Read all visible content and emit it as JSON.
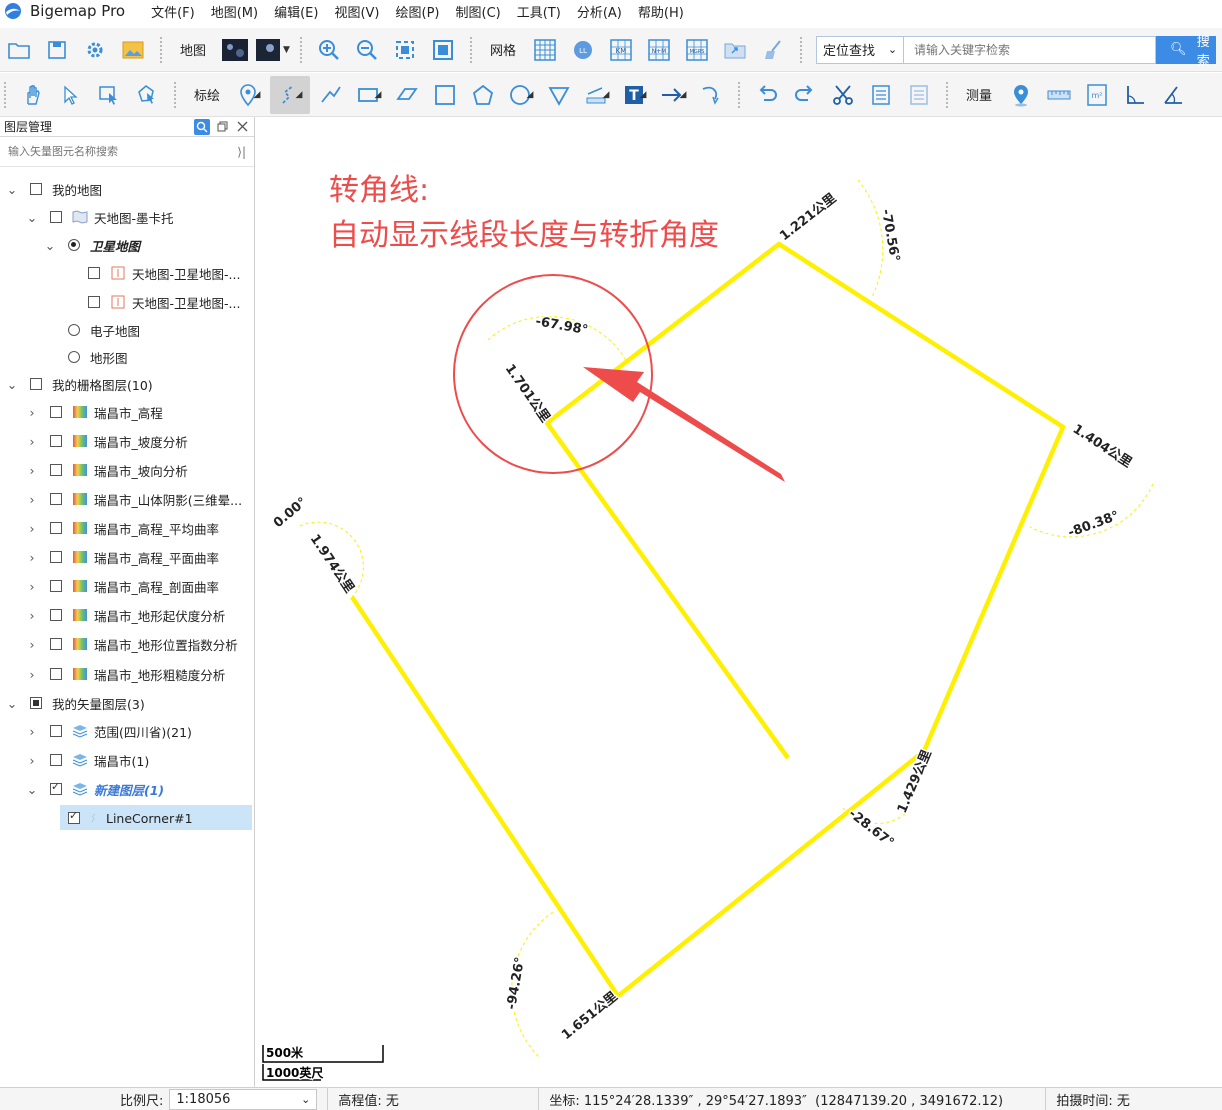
{
  "app": {
    "title": "Bigemap Pro"
  },
  "menu": [
    "文件(F)",
    "地图(M)",
    "编辑(E)",
    "视图(V)",
    "绘图(P)",
    "制图(C)",
    "工具(T)",
    "分析(A)",
    "帮助(H)"
  ],
  "toolbar1": {
    "map_label": "地图",
    "grid_label": "网格",
    "grid_icons": [
      "LL",
      "KM",
      "N+M",
      "MGRS"
    ],
    "locate_label": "定位查找",
    "search_placeholder": "请输入关键字检索",
    "search_button": "搜索"
  },
  "toolbar2": {
    "draw_label": "标绘",
    "text_tool_glyph": "T",
    "area_unit_glyph": "m²",
    "measure_label": "测量"
  },
  "layer_panel": {
    "title": "图层管理",
    "search_placeholder": "输入矢量图元名称搜索",
    "tree": [
      "我的地图",
      "天地图-墨卡托",
      "卫星地图",
      "天地图-卫星地图-...",
      "天地图-卫星地图-...",
      "电子地图",
      "地形图",
      "我的栅格图层(10)",
      "瑞昌市_高程",
      "瑞昌市_坡度分析",
      "瑞昌市_坡向分析",
      "瑞昌市_山体阴影(三维晕...",
      "瑞昌市_高程_平均曲率",
      "瑞昌市_高程_平面曲率",
      "瑞昌市_高程_剖面曲率",
      "瑞昌市_地形起伏度分析",
      "瑞昌市_地形位置指数分析",
      "瑞昌市_地形粗糙度分析",
      "我的矢量图层(3)",
      "范围(四川省)(21)",
      "瑞昌市(1)",
      "新建图层(1)",
      "LineCorner#1"
    ]
  },
  "map": {
    "annotation_line1": "转角线:",
    "annotation_line2": "自动显示线段长度与转折角度",
    "annotation_color": "#ee4b4b",
    "line_color": "#ffef00",
    "segment_lengths": [
      "1.974公里",
      "1.651公里",
      "1.429公里",
      "1.404公里",
      "1.221公里",
      "1.701公里"
    ],
    "turn_angles": [
      "0.00°",
      "-94.26°",
      "-28.67°",
      "-80.38°",
      "-70.56°",
      "-67.98°"
    ],
    "scale_bar": {
      "metric": "500米",
      "imperial": "1000英尺"
    }
  },
  "status": {
    "scale_label": "比例尺:",
    "scale_value": "1:18056",
    "elevation": "高程值: 无",
    "coords": "坐标: 115°24′28.1339″ , 29°54′27.1893″  (12847139.20 , 3491672.12)",
    "capture_time": "拍摄时间: 无"
  }
}
